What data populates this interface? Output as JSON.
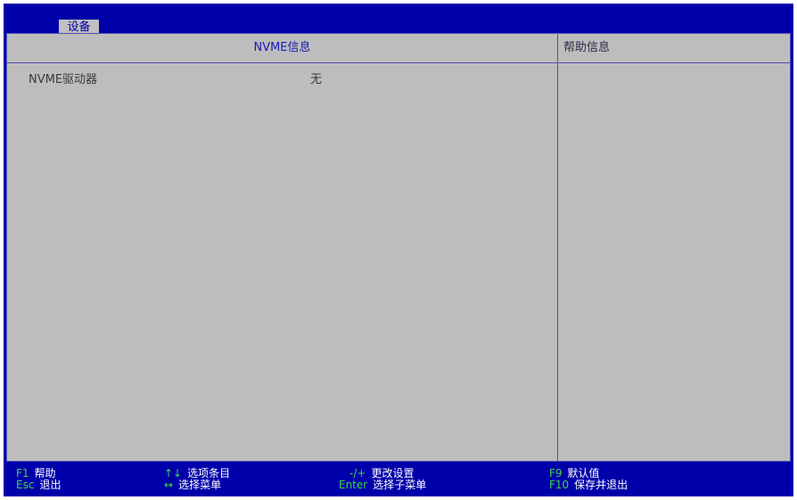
{
  "tab": {
    "label": "设备"
  },
  "panel": {
    "title": "NVME信息",
    "help_title": "帮助信息",
    "rows": [
      {
        "label": "NVME驱动器",
        "value": "无"
      }
    ]
  },
  "footer": {
    "hints": [
      {
        "key": "F1",
        "desc": "帮助"
      },
      {
        "key": "Esc",
        "desc": "退出"
      },
      {
        "key": "↑↓",
        "desc": "选项条目"
      },
      {
        "key": "↔",
        "desc": "选择菜单"
      },
      {
        "key": "-/+",
        "desc": "更改设置"
      },
      {
        "key": "Enter",
        "desc": "选择子菜单"
      },
      {
        "key": "F9",
        "desc": "默认值"
      },
      {
        "key": "F10",
        "desc": "保存并退出"
      }
    ]
  },
  "colors": {
    "screen_bg": "#0000aa",
    "panel_bg": "#bdbdbd",
    "key_green": "#44d444"
  }
}
